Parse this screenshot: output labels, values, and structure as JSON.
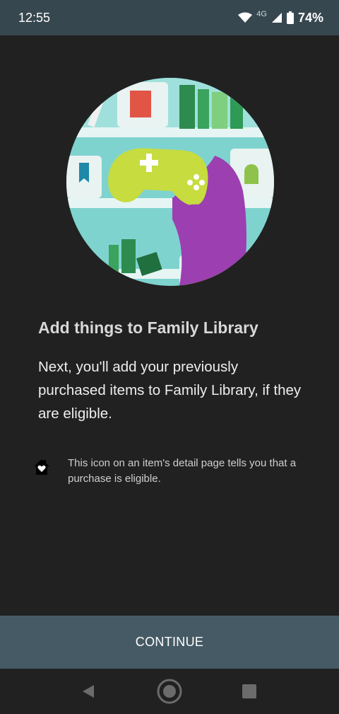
{
  "status": {
    "time": "12:55",
    "network": "4G",
    "battery": "74%"
  },
  "icons": {
    "wifi": "wifi-icon",
    "signal": "cell-signal-icon",
    "battery": "battery-icon",
    "family_library": "family-library-home-heart-icon",
    "back": "back-triangle-icon",
    "home": "home-circle-icon",
    "recents": "recents-square-icon"
  },
  "main": {
    "title": "Add things to Family Library",
    "description": "Next, you'll add your previously purchased items to Family Library, if they are eligible.",
    "note": "This icon on an item's detail page tells you that a purchase is eligible."
  },
  "footer": {
    "continue_label": "CONTINUE"
  },
  "colors": {
    "status_bar": "#37474f",
    "background": "#212121",
    "continue_bar": "#455a64",
    "illustration_bg": "#7fd3cf",
    "controller": "#c6dc3f",
    "hand": "#9c3fb0"
  }
}
